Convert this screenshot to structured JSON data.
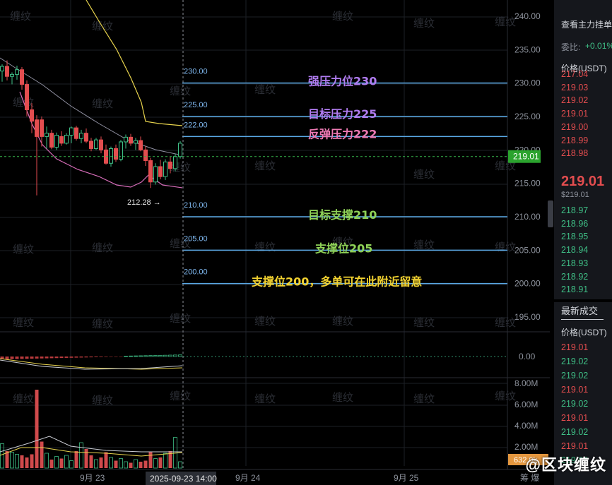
{
  "price_axis": {
    "ticks": [
      "240.00",
      "235.00",
      "230.00",
      "225.00",
      "220.00",
      "215.00",
      "210.00",
      "205.00",
      "200.00",
      "195.00"
    ],
    "current_price_tag": "219.01"
  },
  "macd_axis": {
    "zero_label": "0.00"
  },
  "volume_axis": {
    "ticks": [
      "8.00M",
      "6.00M",
      "4.00M",
      "2.00M"
    ],
    "current_volume_tag": "632.0k"
  },
  "time_axis": {
    "labels": [
      "9月 23",
      "9月 24",
      "9月 25"
    ],
    "crosshair_time": "2025-09-23 14:00",
    "right_text": "筹 爆"
  },
  "annotations": {
    "low_marker": "212.28",
    "levels": [
      {
        "value_label": "230.00",
        "text": "强压力位230",
        "color": "#b07cf0"
      },
      {
        "value_label": "225.00",
        "text": "目标压力225",
        "color": "#b07cf0"
      },
      {
        "value_label": "222.00",
        "text": "反弹压力222",
        "color": "#ee7ab4"
      },
      {
        "value_label": "210.00",
        "text": "目标支撑210",
        "color": "#8fd257"
      },
      {
        "value_label": "205.00",
        "text": "支撑位205",
        "color": "#8fd257"
      },
      {
        "value_label": "200.00",
        "text": "支撑位200，多单可在此附近留意",
        "color": "#f2d230"
      }
    ],
    "line_color": "#5aa9e6"
  },
  "watermarks": {
    "chart_text": "缠纹",
    "corner_text": "@区块缠纹"
  },
  "order_book": {
    "title": "查看主力挂单",
    "ratio_label": "委比:",
    "ratio_value": "+0.01%",
    "price_header": "价格(USDT)",
    "asks": [
      "217.04",
      "219.03",
      "219.02",
      "219.01",
      "219.00",
      "218.99",
      "218.98"
    ],
    "last_price": "219.01",
    "last_price_usd": "$219.01",
    "bids": [
      "218.97",
      "218.96",
      "218.95",
      "218.94",
      "218.93",
      "218.92",
      "218.91"
    ]
  },
  "trades": {
    "title": "最新成交",
    "price_header": "价格(USDT)",
    "rows": [
      {
        "p": "219.01",
        "side": "sell"
      },
      {
        "p": "219.02",
        "side": "buy"
      },
      {
        "p": "219.02",
        "side": "buy"
      },
      {
        "p": "219.01",
        "side": "sell"
      },
      {
        "p": "219.02",
        "side": "buy"
      },
      {
        "p": "219.01",
        "side": "sell"
      },
      {
        "p": "219.02",
        "side": "buy"
      },
      {
        "p": "219.01",
        "side": "sell"
      },
      {
        "p": "219.02",
        "side": "buy"
      }
    ]
  },
  "colors": {
    "up": "#3fbf86",
    "down": "#e34d4f",
    "grid": "#1d2026",
    "axis_text": "#8d929c"
  },
  "candles": [
    {
      "o": 231.8,
      "h": 232.8,
      "l": 230.2,
      "c": 232.5
    },
    {
      "o": 232.5,
      "h": 233.4,
      "l": 230.4,
      "c": 231.0
    },
    {
      "o": 231.0,
      "h": 231.6,
      "l": 229.8,
      "c": 231.3
    },
    {
      "o": 231.3,
      "h": 232.6,
      "l": 230.5,
      "c": 232.0
    },
    {
      "o": 232.0,
      "h": 232.4,
      "l": 229.0,
      "c": 229.8
    },
    {
      "o": 229.8,
      "h": 230.4,
      "l": 225.0,
      "c": 226.0
    },
    {
      "o": 226.0,
      "h": 227.0,
      "l": 222.5,
      "c": 224.3
    },
    {
      "o": 224.5,
      "h": 225.2,
      "l": 213.2,
      "c": 222.0
    },
    {
      "o": 224.5,
      "h": 225.0,
      "l": 220.5,
      "c": 222.0
    },
    {
      "o": 222.0,
      "h": 223.5,
      "l": 220.2,
      "c": 222.5
    },
    {
      "o": 222.5,
      "h": 223.0,
      "l": 220.1,
      "c": 220.4
    },
    {
      "o": 220.4,
      "h": 222.6,
      "l": 220.0,
      "c": 222.2
    },
    {
      "o": 222.0,
      "h": 222.8,
      "l": 220.6,
      "c": 221.0
    },
    {
      "o": 221.0,
      "h": 222.5,
      "l": 220.8,
      "c": 222.2
    },
    {
      "o": 222.2,
      "h": 223.5,
      "l": 221.0,
      "c": 223.3
    },
    {
      "o": 223.3,
      "h": 223.6,
      "l": 221.4,
      "c": 221.7
    },
    {
      "o": 221.7,
      "h": 223.0,
      "l": 221.0,
      "c": 222.5
    },
    {
      "o": 222.5,
      "h": 223.2,
      "l": 221.0,
      "c": 221.3
    },
    {
      "o": 221.3,
      "h": 221.8,
      "l": 219.8,
      "c": 220.2
    },
    {
      "o": 220.2,
      "h": 221.8,
      "l": 220.0,
      "c": 221.5
    },
    {
      "o": 221.5,
      "h": 222.0,
      "l": 219.5,
      "c": 220.0
    },
    {
      "o": 220.0,
      "h": 220.8,
      "l": 217.8,
      "c": 218.0
    },
    {
      "o": 218.0,
      "h": 220.5,
      "l": 217.5,
      "c": 220.2
    },
    {
      "o": 220.2,
      "h": 220.8,
      "l": 218.2,
      "c": 218.6
    },
    {
      "o": 218.6,
      "h": 221.5,
      "l": 218.3,
      "c": 221.2
    },
    {
      "o": 221.2,
      "h": 222.3,
      "l": 220.2,
      "c": 221.9
    },
    {
      "o": 221.9,
      "h": 222.4,
      "l": 220.6,
      "c": 221.0
    },
    {
      "o": 221.0,
      "h": 221.8,
      "l": 220.0,
      "c": 221.4
    },
    {
      "o": 221.4,
      "h": 222.0,
      "l": 219.8,
      "c": 220.0
    },
    {
      "o": 220.0,
      "h": 220.6,
      "l": 217.6,
      "c": 218.4
    },
    {
      "o": 218.4,
      "h": 218.8,
      "l": 214.3,
      "c": 215.2
    },
    {
      "o": 215.2,
      "h": 218.0,
      "l": 214.8,
      "c": 217.5
    },
    {
      "o": 217.5,
      "h": 218.5,
      "l": 215.6,
      "c": 216.0
    },
    {
      "o": 216.0,
      "h": 218.6,
      "l": 215.5,
      "c": 218.2
    },
    {
      "o": 218.2,
      "h": 219.0,
      "l": 216.5,
      "c": 217.2
    },
    {
      "o": 217.2,
      "h": 219.4,
      "l": 216.8,
      "c": 219.0
    },
    {
      "o": 219.0,
      "h": 221.3,
      "l": 218.7,
      "c": 221.0
    }
  ],
  "volumes": [
    2.3,
    1.6,
    1.5,
    1.3,
    1.2,
    1.0,
    1.3,
    7.4,
    2.5,
    1.4,
    0.8,
    1.1,
    0.9,
    1.2,
    0.7,
    1.6,
    2.4,
    1.8,
    1.2,
    0.8,
    1.0,
    1.5,
    1.0,
    0.7,
    0.9,
    0.6,
    0.5,
    0.8,
    0.6,
    0.7,
    1.5,
    0.9,
    1.0,
    1.4,
    1.6,
    2.9,
    0.6
  ]
}
